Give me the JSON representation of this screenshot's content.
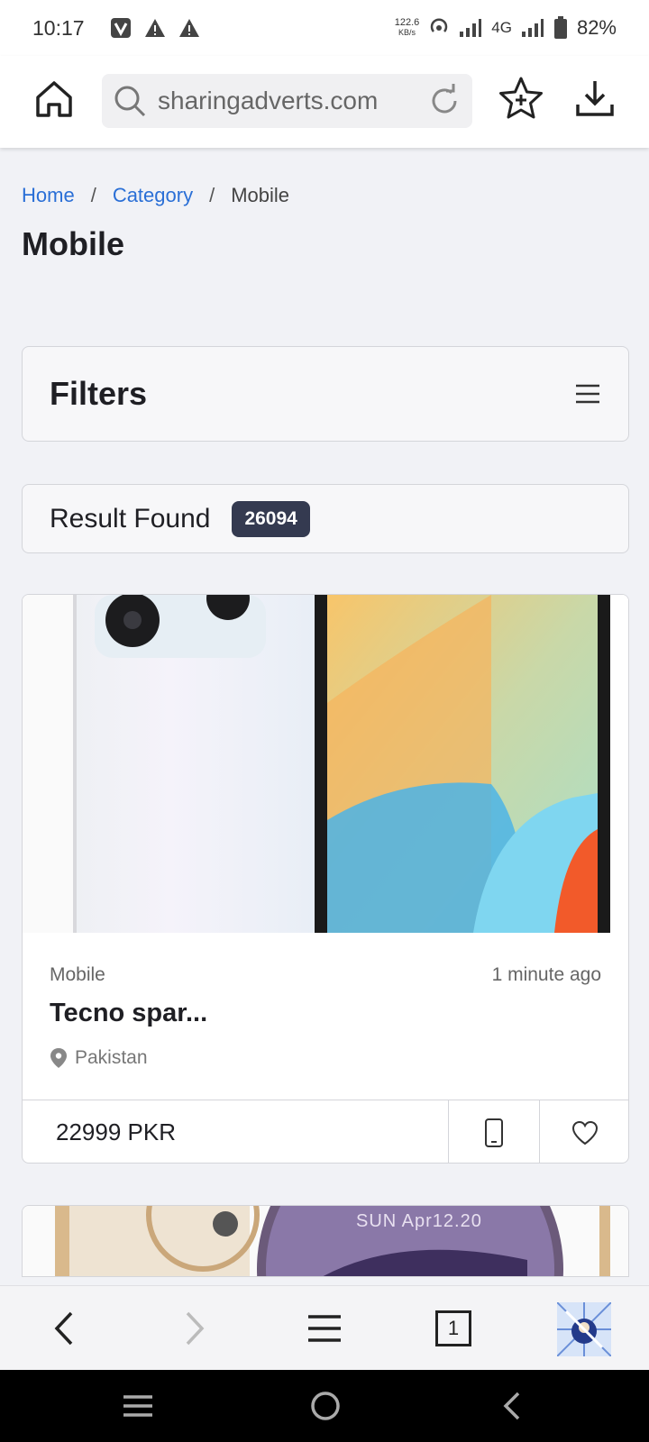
{
  "status_bar": {
    "time": "10:17",
    "net_speed_value": "122.6",
    "net_speed_unit": "KB/s",
    "network_type": "4G",
    "battery": "82%"
  },
  "browser": {
    "url": "sharingadverts.com",
    "tab_count": "1"
  },
  "breadcrumb": {
    "home": "Home",
    "separator": "/",
    "category": "Category",
    "current": "Mobile"
  },
  "page": {
    "title": "Mobile"
  },
  "filters": {
    "title": "Filters"
  },
  "results": {
    "label": "Result Found",
    "count": "26094"
  },
  "listings": [
    {
      "category": "Mobile",
      "time": "1 minute ago",
      "title": "Tecno spar...",
      "location": "Pakistan",
      "price": "22999 PKR"
    },
    {
      "image_text": "SUN Apr12.20"
    }
  ],
  "colors": {
    "link": "#2a6fd6",
    "badge_bg": "#343a50",
    "page_bg": "#f1f2f6"
  }
}
